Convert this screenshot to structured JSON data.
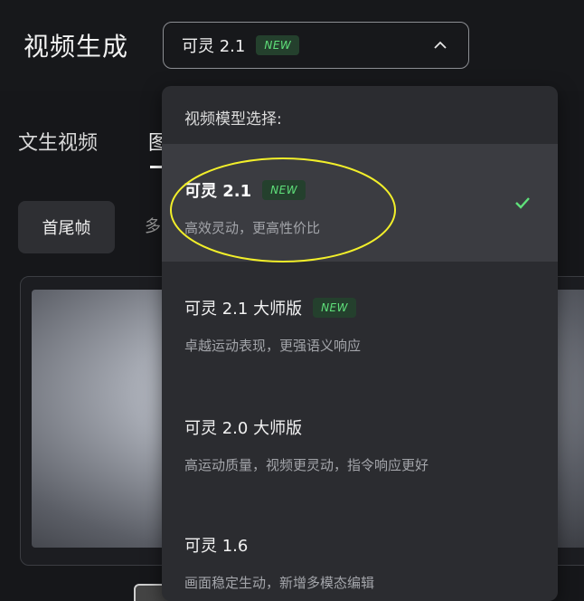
{
  "header": {
    "title": "视频生成",
    "model_select": {
      "value": "可灵 2.1",
      "badge": "NEW"
    }
  },
  "background": {
    "tabs": [
      "文生视频",
      "图"
    ],
    "chips": [
      "首尾帧",
      "多"
    ]
  },
  "dropdown": {
    "title": "视频模型选择:",
    "options": [
      {
        "name": "可灵 2.1",
        "badge": "NEW",
        "desc": "高效灵动，更高性价比",
        "selected": true
      },
      {
        "name": "可灵 2.1 大师版",
        "badge": "NEW",
        "desc": "卓越运动表现，更强语义响应",
        "selected": false
      },
      {
        "name": "可灵 2.0 大师版",
        "badge": "",
        "desc": "高运动质量，视频更灵动，指令响应更好",
        "selected": false
      },
      {
        "name": "可灵 1.6",
        "badge": "",
        "desc": "画面稳定生动，新增多模态编辑",
        "selected": false
      }
    ]
  },
  "colors": {
    "badge_bg": "#24402d",
    "badge_text": "#5fe07a",
    "check": "#5fe07a",
    "annotation_ellipse": "#f2ef2a"
  }
}
